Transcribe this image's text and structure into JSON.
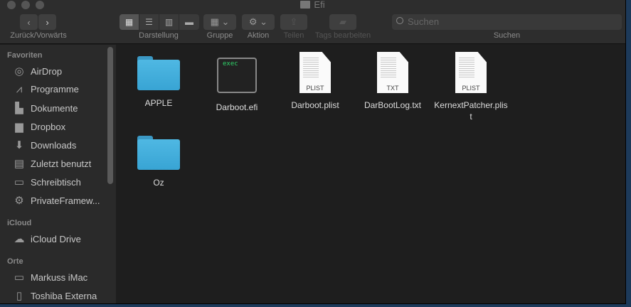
{
  "window": {
    "title": "Efi"
  },
  "toolbar": {
    "nav_label": "Zurück/Vorwärts",
    "view_label": "Darstellung",
    "group_label": "Gruppe",
    "action_label": "Aktion",
    "share_label": "Teilen",
    "tags_label": "Tags bearbeiten",
    "search_label": "Suchen",
    "search_placeholder": "Suchen"
  },
  "sidebar": {
    "favorites_header": "Favoriten",
    "favorites": [
      {
        "label": "AirDrop",
        "icon": "airdrop-icon"
      },
      {
        "label": "Programme",
        "icon": "applications-icon"
      },
      {
        "label": "Dokumente",
        "icon": "documents-icon"
      },
      {
        "label": "Dropbox",
        "icon": "folder-icon"
      },
      {
        "label": "Downloads",
        "icon": "downloads-icon"
      },
      {
        "label": "Zuletzt benutzt",
        "icon": "recents-icon"
      },
      {
        "label": "Schreibtisch",
        "icon": "desktop-icon"
      },
      {
        "label": "PrivateFramew...",
        "icon": "gear-icon"
      }
    ],
    "icloud_header": "iCloud",
    "icloud": [
      {
        "label": "iCloud Drive",
        "icon": "cloud-icon"
      }
    ],
    "places_header": "Orte",
    "places": [
      {
        "label": "Markuss iMac",
        "icon": "imac-icon"
      },
      {
        "label": "Toshiba Externa",
        "icon": "drive-icon"
      }
    ]
  },
  "files": [
    {
      "name": "APPLE",
      "kind": "folder"
    },
    {
      "name": "Darboot.efi",
      "kind": "exec",
      "badge": "exec"
    },
    {
      "name": "Darboot.plist",
      "kind": "doc",
      "badge": "PLIST"
    },
    {
      "name": "DarBootLog.txt",
      "kind": "doc",
      "badge": "TXT"
    },
    {
      "name": "KernextPatcher.plist",
      "kind": "doc",
      "badge": "PLIST"
    },
    {
      "name": "Oz",
      "kind": "folder"
    }
  ]
}
